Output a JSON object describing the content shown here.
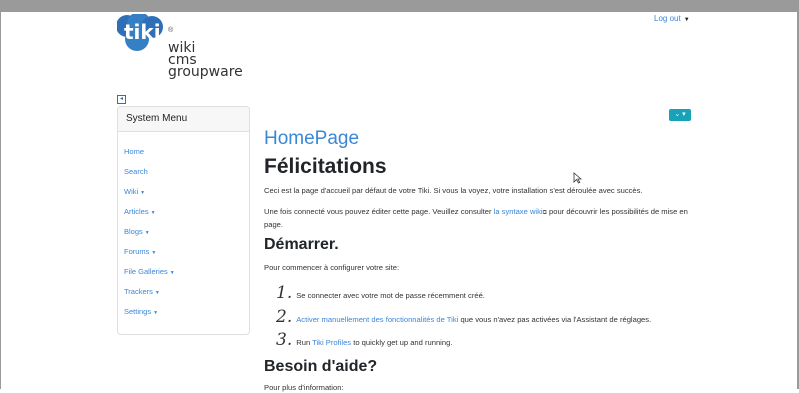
{
  "header": {
    "logo_words": [
      "wiki",
      "cms",
      "groupware"
    ],
    "logo_mark": "tiki",
    "logout_label": "Log out"
  },
  "sidebar": {
    "title": "System Menu",
    "items": [
      {
        "label": "Home",
        "dropdown": false
      },
      {
        "label": "Search",
        "dropdown": false
      },
      {
        "label": "Wiki",
        "dropdown": true
      },
      {
        "label": "Articles",
        "dropdown": true
      },
      {
        "label": "Blogs",
        "dropdown": true
      },
      {
        "label": "Forums",
        "dropdown": true
      },
      {
        "label": "File Galleries",
        "dropdown": true
      },
      {
        "label": "Trackers",
        "dropdown": true
      },
      {
        "label": "Settings",
        "dropdown": true
      }
    ]
  },
  "main": {
    "page_title": "HomePage",
    "heading": "Félicitations",
    "intro": "Ceci est la page d'accueil par défaut de votre Tiki. Si vous la voyez, votre installation s'est déroulée avec succès.",
    "edit_prefix": "Une fois connecté vous pouvez éditer cette page. Veuillez consulter ",
    "edit_link": "la syntaxe wiki",
    "edit_suffix": " pour découvrir les possibilités de mise en page.",
    "start_heading": "Démarrer.",
    "start_intro": "Pour commencer à configurer votre site:",
    "steps": [
      {
        "num": "1.",
        "pre": "Se connecter avec votre mot de passe récemment créé.",
        "link": "",
        "post": ""
      },
      {
        "num": "2.",
        "pre": "",
        "link": "Activer manuellement des fonctionnalités de Tiki",
        "post": " que vous n'avez pas activées via l'Assistant de réglages."
      },
      {
        "num": "3.",
        "pre": "Run ",
        "link": "Tiki Profiles",
        "post": " to quickly get up and running."
      }
    ],
    "help_heading": "Besoin d'aide?",
    "help_intro": "Pour plus d'information:"
  },
  "colors": {
    "link": "#3a87d8",
    "teal_button": "#17a2b8",
    "logo_blue": "#2f6fb7"
  }
}
